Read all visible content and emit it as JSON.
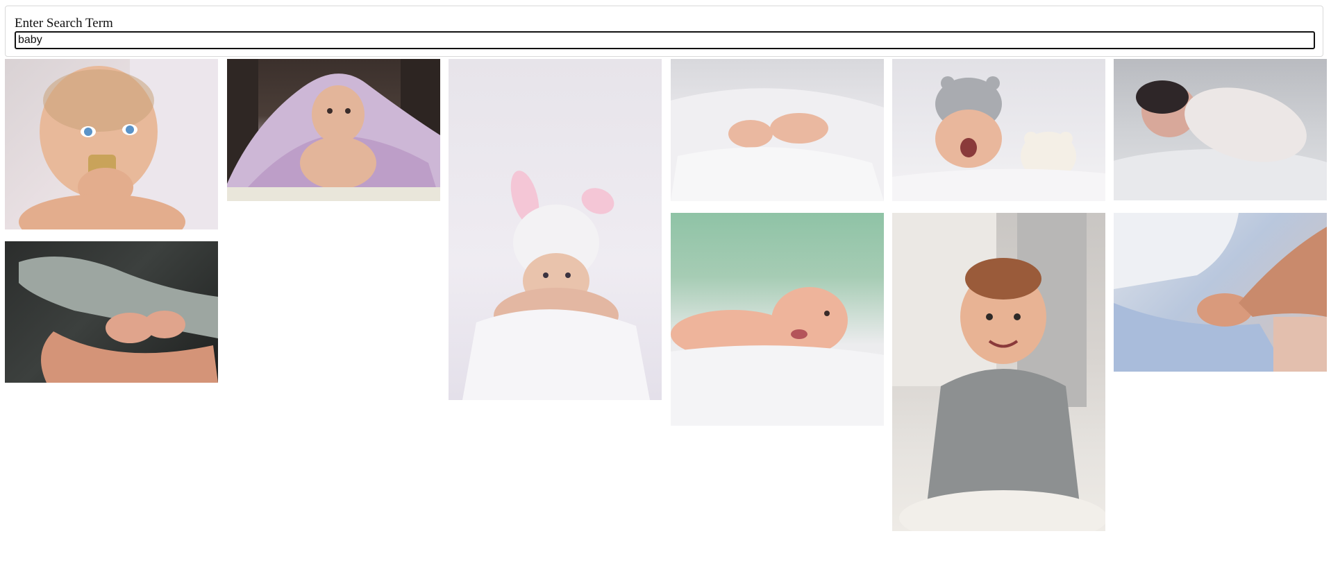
{
  "search": {
    "label": "Enter Search Term",
    "value": "baby"
  },
  "results": [
    {
      "name": "baby-eating-block-photo",
      "background": "linear-gradient(135deg,#d9d2d4 0%,#e8dfe2 45%,#f3eef1 100%)",
      "skin": "#e8b99a"
    },
    {
      "name": "baby-under-purple-blanket-photo",
      "background": "linear-gradient(180deg,#3b302c 0%,#4b3e38 40%,#e2d6e6 75%,#ece4e2 100%)",
      "skin": "#e3b59a"
    },
    {
      "name": "baby-bunny-hat-photo",
      "background": "linear-gradient(180deg,#e7e4ea 0%,#efecf2 60%,#e4e0ea 100%)",
      "skin": "#e9c3ac"
    },
    {
      "name": "baby-feet-white-blanket-photo",
      "background": "linear-gradient(180deg,#d8d8dc 0%,#ecebef 55%,#f6f6f7 100%)",
      "skin": "#eab8a0"
    },
    {
      "name": "baby-yawning-teddy-photo",
      "background": "linear-gradient(180deg,#e2e1e6 0%,#ebeaee 55%,#f3f2f4 100%)",
      "skin": "#e9b79c"
    },
    {
      "name": "baby-swaddled-sleeping-photo",
      "background": "linear-gradient(180deg,#b9bbc0 0%,#cfd1d5 50%,#e1e2e5 100%)",
      "skin": "#d8a89a"
    },
    {
      "name": "baby-feet-in-hands-photo",
      "background": "linear-gradient(135deg,#2b2d2c 0%,#3c403e 45%,#1e201f 100%)",
      "skin": "#e0a48c"
    },
    {
      "name": "baby-smiling-lying-photo",
      "background": "linear-gradient(180deg,#8fc3a6 0%,#a6ccb4 30%,#ececee 62%,#f2f2f4 100%)",
      "skin": "#eeb49b"
    },
    {
      "name": "baby-sitting-grey-outfit-photo",
      "background": "linear-gradient(180deg,#c9c6c3 0%,#d8d4d0 45%,#e6e3df 75%,#eeebe6 100%)",
      "skin": "#e8b394"
    },
    {
      "name": "baby-hand-holding-finger-photo",
      "background": "linear-gradient(135deg,#dfe3ea 0%,#b9c7dd 45%,#d6c3bb 100%)",
      "skin": "#d99a7c"
    }
  ]
}
